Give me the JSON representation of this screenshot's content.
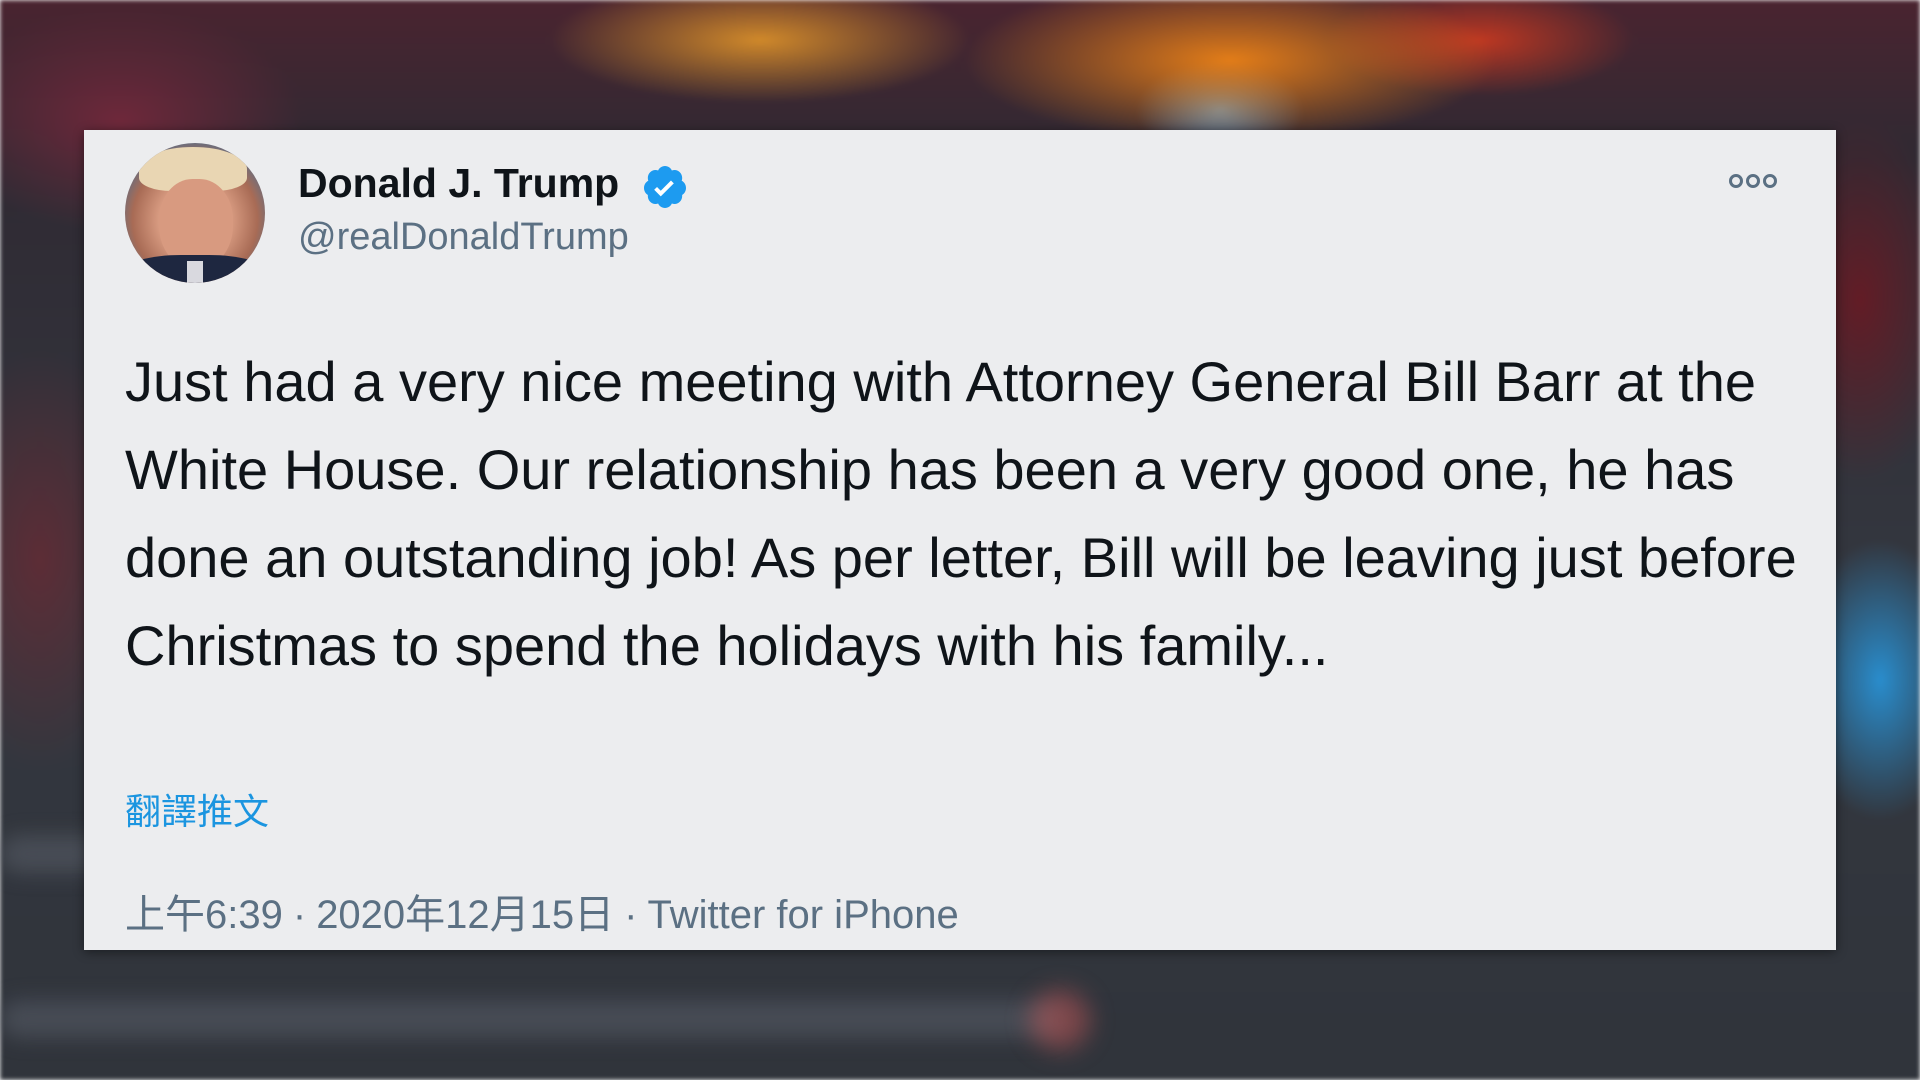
{
  "tweet": {
    "author_name": "Donald J. Trump",
    "handle": "@realDonaldTrump",
    "verified": true,
    "text": "Just had a very nice meeting with Attorney General Bill Barr at the White House. Our relationship has been a very good one, he has done an outstanding job! As per letter, Bill will be leaving just before Christmas to spend the holidays with his family...",
    "translate_label": "翻譯推文",
    "time": "上午6:39",
    "date": "2020年12月15日",
    "source": "Twitter for iPhone",
    "separator": "·"
  },
  "icons": {
    "verified": "verified-badge-icon",
    "more": "more-options-icon",
    "avatar": "avatar-image"
  },
  "colors": {
    "card_background": "#ecedef",
    "text": "#0f1419",
    "secondary_text": "#5b7083",
    "link": "#1b95e0",
    "verified_badge": "#1d9bf0"
  }
}
